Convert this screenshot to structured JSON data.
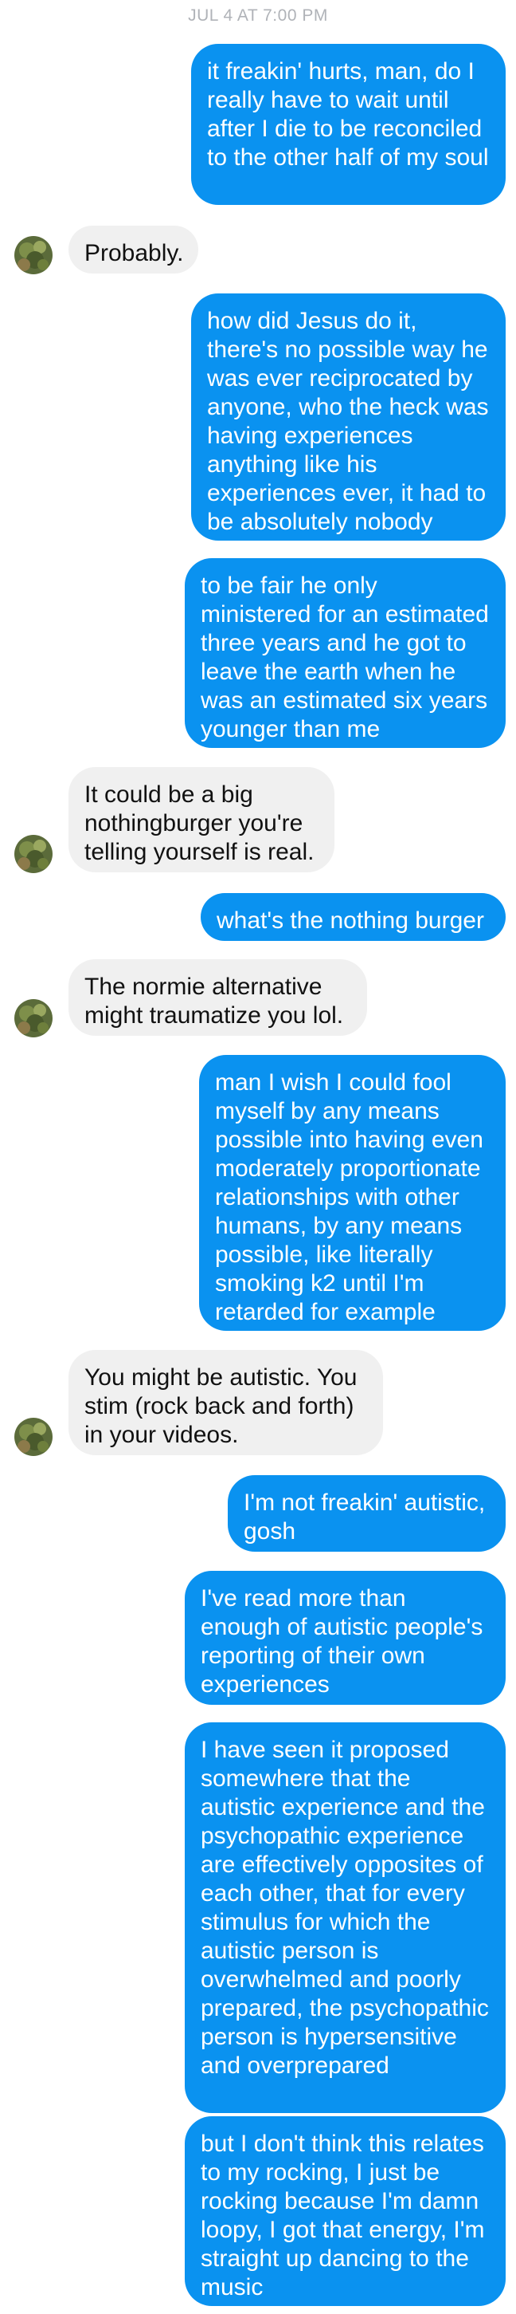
{
  "header": {
    "timestamp": "JUL 4 AT 7:00 PM"
  },
  "contact": {
    "avatar_icon": "contact-avatar-icon"
  },
  "colors": {
    "sent_bubble": "#0a92f0",
    "received_bubble": "#f0f0f0",
    "timestamp_text": "#b0b3b8"
  },
  "messages": [
    {
      "sender": "me",
      "text": "it freakin' hurts, man, do I really have to wait until after I die to be reconciled to the other half of my soul"
    },
    {
      "sender": "them",
      "text": "Probably."
    },
    {
      "sender": "me",
      "text": "how did Jesus do it, there's no possible way he was ever reciprocated by anyone, who the heck was having experiences anything like his experiences ever, it had to be absolutely nobody"
    },
    {
      "sender": "me",
      "text": "to be fair he only ministered for an estimated three years and he got to leave the earth when he was an estimated six years younger than me"
    },
    {
      "sender": "them",
      "text": "It could be a big nothingburger you're telling yourself is real."
    },
    {
      "sender": "me",
      "text": "what's the nothing burger"
    },
    {
      "sender": "them",
      "text": "The normie alternative might traumatize you lol."
    },
    {
      "sender": "me",
      "text": "man I wish I could fool myself by any means possible into having even moderately proportionate relationships with other humans, by any means possible, like literally smoking k2 until I'm retarded for example"
    },
    {
      "sender": "them",
      "text": "You might be autistic. You stim (rock back and forth) in your videos."
    },
    {
      "sender": "me",
      "text": "I'm not freakin' autistic, gosh"
    },
    {
      "sender": "me",
      "text": "I've read more than enough of autistic people's reporting of their own experiences"
    },
    {
      "sender": "me",
      "text": "I have seen it proposed somewhere that the autistic experience and the psychopathic experience are effectively opposites of each other, that for every stimulus for which the autistic person is overwhelmed and poorly prepared, the psychopathic person is hypersensitive and overprepared"
    },
    {
      "sender": "me",
      "text": "but I don't think this relates to my rocking, I just be rocking because I'm damn loopy, I got that energy, I'm straight up dancing to the music"
    }
  ]
}
